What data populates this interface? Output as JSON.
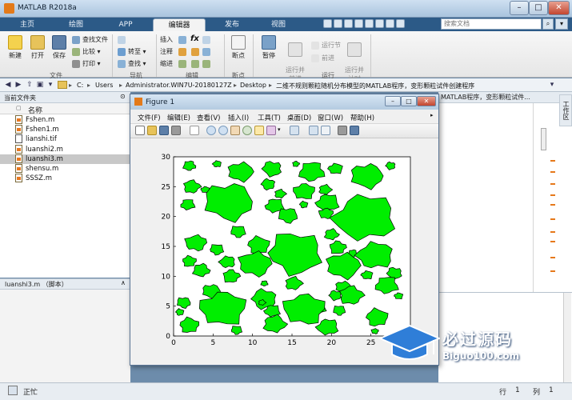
{
  "window": {
    "title": "MATLAB R2018a",
    "min": "–",
    "max": "□",
    "close": "✕"
  },
  "ribbon_tabs": [
    {
      "label": "主页"
    },
    {
      "label": "绘图"
    },
    {
      "label": "APP"
    },
    {
      "label": "编辑器"
    },
    {
      "label": "发布"
    },
    {
      "label": "视图"
    }
  ],
  "search": {
    "placeholder": "搜索文档"
  },
  "ribbon": {
    "file": {
      "new": "新建",
      "open": "打开",
      "save": "保存",
      "find_files": "查找文件",
      "compare": "比较",
      "print": "打印",
      "group": "文件"
    },
    "nav": {
      "goto": "转至",
      "find": "查找",
      "group": "导航"
    },
    "edit": {
      "insert": "插入",
      "comment": "注释",
      "indent": "缩进",
      "fx": "fx",
      "group": "编辑"
    },
    "breakpoint": {
      "label": "断点",
      "group": "断点"
    },
    "run": {
      "pause": "暂停",
      "run_advance": "运行并\n前进",
      "run_section": "运行节",
      "advance": "前进",
      "run_time": "运行并\n计时",
      "group": "运行"
    }
  },
  "path": [
    "C:",
    "Users",
    "Administrator.WIN7U-20180127Z",
    "Desktop",
    "二维不规则颗粒随机分布模型的MATLAB程序，变形颗粒试件创建程序"
  ],
  "left_panel": {
    "title": "当前文件夹",
    "col_name": "名称",
    "files": [
      {
        "name": "Fshen.m",
        "type": "m"
      },
      {
        "name": "Fshen1.m",
        "type": "m"
      },
      {
        "name": "lianshi.tif",
        "type": "tif"
      },
      {
        "name": "luanshi2.m",
        "type": "m"
      },
      {
        "name": "luanshi3.m",
        "type": "m",
        "selected": true
      },
      {
        "name": "shensu.m",
        "type": "m"
      },
      {
        "name": "SSSZ.m",
        "type": "m"
      }
    ],
    "detail_title": "luanshi3.m （脚本）"
  },
  "editor_tab": "MATLAB程序，变形颗粒试件...",
  "side_label": "工作区",
  "status": {
    "text": "正忙",
    "row_label": "行",
    "row": "1",
    "col_label": "列",
    "col": "1"
  },
  "figure": {
    "title": "Figure 1",
    "menus": [
      "文件(F)",
      "编辑(E)",
      "查看(V)",
      "插入(I)",
      "工具(T)",
      "桌面(D)",
      "窗口(W)",
      "帮助(H)"
    ]
  },
  "colors": {
    "particle": "#00ee00",
    "particle_edge": "#000000",
    "accent": "#2c5a87"
  },
  "chart_data": {
    "type": "scatter",
    "title": "",
    "xlabel": "",
    "ylabel": "",
    "xlim": [
      0,
      30
    ],
    "ylim": [
      0,
      30
    ],
    "xticks": [
      0,
      5,
      10,
      15,
      20,
      25
    ],
    "yticks": [
      0,
      5,
      10,
      15,
      20,
      25,
      30
    ],
    "grid": false,
    "particles": [
      {
        "x": 2,
        "y": 28.5,
        "r": 0.9
      },
      {
        "x": 5.5,
        "y": 28.8,
        "r": 0.6
      },
      {
        "x": 8.5,
        "y": 27.5,
        "r": 1.8
      },
      {
        "x": 12.5,
        "y": 28,
        "r": 1.4
      },
      {
        "x": 15.5,
        "y": 28.8,
        "r": 0.5
      },
      {
        "x": 17.5,
        "y": 27.5,
        "r": 1.8
      },
      {
        "x": 20.5,
        "y": 28,
        "r": 1
      },
      {
        "x": 24.5,
        "y": 26.8,
        "r": 2.3
      },
      {
        "x": 27.5,
        "y": 28.5,
        "r": 0.7
      },
      {
        "x": 2.3,
        "y": 25,
        "r": 1.2
      },
      {
        "x": 1.8,
        "y": 22,
        "r": 1
      },
      {
        "x": 4,
        "y": 24.5,
        "r": 0.6
      },
      {
        "x": 7,
        "y": 22.5,
        "r": 3.5
      },
      {
        "x": 12,
        "y": 25.4,
        "r": 1
      },
      {
        "x": 13.5,
        "y": 23.8,
        "r": 0.8
      },
      {
        "x": 12.8,
        "y": 21.8,
        "r": 1.3
      },
      {
        "x": 16.5,
        "y": 24.2,
        "r": 1.5
      },
      {
        "x": 14.5,
        "y": 20.2,
        "r": 1.4
      },
      {
        "x": 16.5,
        "y": 22,
        "r": 0.6
      },
      {
        "x": 19.2,
        "y": 24.5,
        "r": 0.9
      },
      {
        "x": 19.5,
        "y": 22.3,
        "r": 1.6
      },
      {
        "x": 19.3,
        "y": 20.5,
        "r": 1
      },
      {
        "x": 8.2,
        "y": 17.5,
        "r": 1.1
      },
      {
        "x": 10.8,
        "y": 15.2,
        "r": 1.6
      },
      {
        "x": 20,
        "y": 17,
        "r": 1
      },
      {
        "x": 24.2,
        "y": 19.8,
        "r": 4.3
      },
      {
        "x": 2.8,
        "y": 15.6,
        "r": 1.5
      },
      {
        "x": 5.5,
        "y": 14.5,
        "r": 1
      },
      {
        "x": 2,
        "y": 12.5,
        "r": 1
      },
      {
        "x": 3.5,
        "y": 11,
        "r": 1.2
      },
      {
        "x": 6.8,
        "y": 12.4,
        "r": 1.1
      },
      {
        "x": 10.3,
        "y": 12.1,
        "r": 2.3
      },
      {
        "x": 15.5,
        "y": 13.9,
        "r": 3.9
      },
      {
        "x": 20.8,
        "y": 14.8,
        "r": 1.2
      },
      {
        "x": 22.7,
        "y": 13.8,
        "r": 0.7
      },
      {
        "x": 25.5,
        "y": 13.5,
        "r": 2.5
      },
      {
        "x": 21.5,
        "y": 11.8,
        "r": 2.4
      },
      {
        "x": 28,
        "y": 10.5,
        "r": 1.1
      },
      {
        "x": 7.3,
        "y": 10,
        "r": 1.2
      },
      {
        "x": 11.5,
        "y": 8.8,
        "r": 0.5
      },
      {
        "x": 24.5,
        "y": 10.2,
        "r": 0.8
      },
      {
        "x": 21.5,
        "y": 8.2,
        "r": 1.1
      },
      {
        "x": 20.5,
        "y": 6.8,
        "r": 0.9
      },
      {
        "x": 22.5,
        "y": 6.8,
        "r": 1.7
      },
      {
        "x": 27,
        "y": 8.5,
        "r": 1.6
      },
      {
        "x": 28.5,
        "y": 6.7,
        "r": 0.6
      },
      {
        "x": 4.8,
        "y": 7.5,
        "r": 1.3
      },
      {
        "x": 11.5,
        "y": 6.2,
        "r": 1.8
      },
      {
        "x": 15.2,
        "y": 8.8,
        "r": 1.2
      },
      {
        "x": 18.5,
        "y": 4.6,
        "r": 0.9
      },
      {
        "x": 6.2,
        "y": 4.6,
        "r": 3.2
      },
      {
        "x": 1.3,
        "y": 5.6,
        "r": 1
      },
      {
        "x": 0.8,
        "y": 4,
        "r": 0.6
      },
      {
        "x": 11.2,
        "y": 5.6,
        "r": 0.5
      },
      {
        "x": 12.5,
        "y": 4.2,
        "r": 1.1
      },
      {
        "x": 16.5,
        "y": 4.5,
        "r": 2.9
      },
      {
        "x": 21,
        "y": 4.3,
        "r": 0.9
      },
      {
        "x": 25.8,
        "y": 3.1,
        "r": 1.6
      },
      {
        "x": 12.8,
        "y": 2,
        "r": 1.6
      },
      {
        "x": 19.5,
        "y": 1.5,
        "r": 1.5
      },
      {
        "x": 25.5,
        "y": 0.8,
        "r": 0.5
      },
      {
        "x": 8,
        "y": 1,
        "r": 0.8
      },
      {
        "x": 2,
        "y": 1.8,
        "r": 1.4
      }
    ]
  },
  "watermark": {
    "brand": "必过源码",
    "url": "Biguo100.com"
  }
}
